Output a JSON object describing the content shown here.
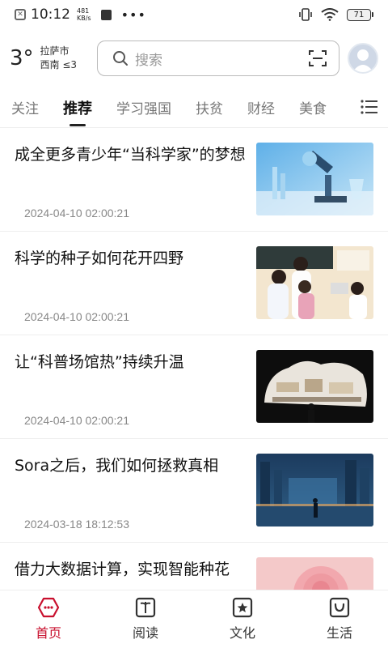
{
  "status_bar": {
    "time": "10:12",
    "speed_value": "481",
    "speed_unit": "KB/s",
    "battery": "71"
  },
  "header": {
    "temperature": "3°",
    "city": "拉萨市",
    "wind": "西南 ≤3",
    "search_placeholder": "搜索"
  },
  "tabs": [
    "关注",
    "推荐",
    "学习强国",
    "扶贫",
    "财经",
    "美食"
  ],
  "active_tab": "推荐",
  "feed": [
    {
      "title": "成全更多青少年“当科学家”的梦想",
      "date": "2024-04-10 02:00:21",
      "thumb": "microscope"
    },
    {
      "title": "科学的种子如何花开四野",
      "date": "2024-04-10 02:00:21",
      "thumb": "classroom"
    },
    {
      "title": "让“科普场馆热”持续升温",
      "date": "2024-04-10 02:00:21",
      "thumb": "museum"
    },
    {
      "title": "Sora之后，我们如何拯救真相",
      "date": "2024-03-18 18:12:53",
      "thumb": "city-night"
    },
    {
      "title": "借力大数据计算，实现智能种花",
      "date": "",
      "thumb": "rose"
    }
  ],
  "bottom_nav": [
    {
      "label": "首页",
      "icon": "home-icon"
    },
    {
      "label": "阅读",
      "icon": "book-icon"
    },
    {
      "label": "文化",
      "icon": "star-icon"
    },
    {
      "label": "生活",
      "icon": "bag-icon"
    }
  ],
  "colors": {
    "accent": "#c8102e"
  }
}
